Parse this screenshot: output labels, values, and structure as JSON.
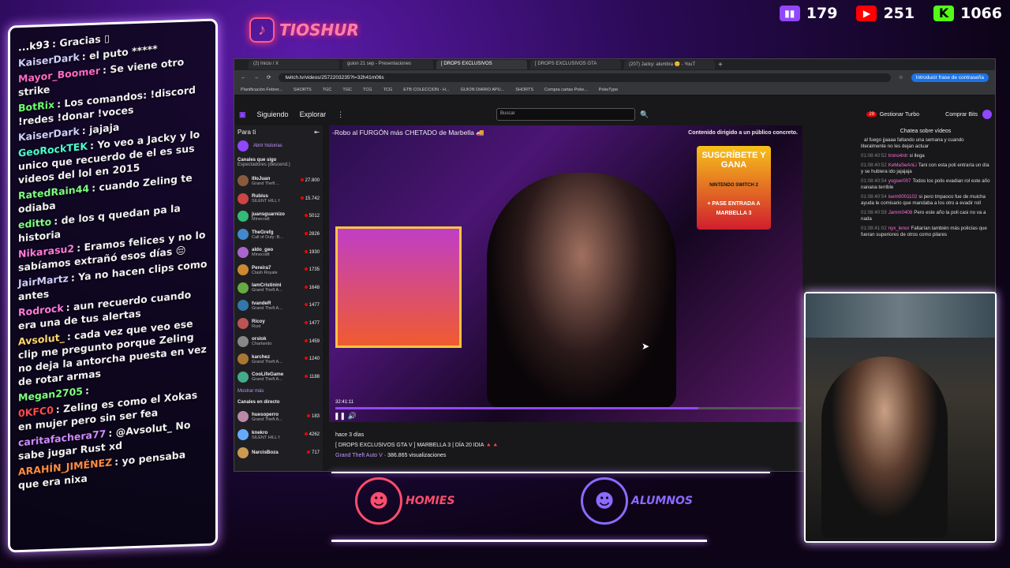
{
  "brand": {
    "name": "TIOSHUR",
    "logo": "tiktok-icon"
  },
  "stats": [
    {
      "platform": "twitch",
      "icon": "twitch-icon",
      "value": "179",
      "color": "#9146ff"
    },
    {
      "platform": "youtube",
      "icon": "youtube-icon",
      "value": "251",
      "color": "#ff0000"
    },
    {
      "platform": "kick",
      "icon": "kick-icon",
      "value": "1066",
      "color": "#53fc18"
    }
  ],
  "chat": [
    {
      "user": "...k93",
      "user_color": "#ffffff",
      "text": ": Gracias ▯"
    },
    {
      "user": "KaiserDark",
      "user_color": "#cfcfff",
      "text": ": el puto *****"
    },
    {
      "user": "Mayor_Boomer",
      "user_color": "#ff69c4",
      "text": ": Se viene otro strike"
    },
    {
      "user": "BotRix",
      "user_color": "#6cff6c",
      "text": ": Los comandos: !discord !redes !donar !voces"
    },
    {
      "user": "KaiserDark",
      "user_color": "#cfcfff",
      "text": ": jajaja"
    },
    {
      "user": "GeoRockTEK",
      "user_color": "#4cffd0",
      "text": ": Yo veo a Jacky y lo unico que recuerdo de el es sus videos del lol en 2015"
    },
    {
      "user": "RatedRain44",
      "user_color": "#7dff7d",
      "text": ": cuando Zeling te odiaba"
    },
    {
      "user": "editto",
      "user_color": "#7dff7d",
      "text": ": de los q quedan pa la historia"
    },
    {
      "user": "Nikarasu2",
      "user_color": "#ff7ad9",
      "text": ": Eramos felices y no lo sabíamos extrañó esos días 😔"
    },
    {
      "user": "JairMartz",
      "user_color": "#cfcfff",
      "text": ": Ya no hacen clips como antes"
    },
    {
      "user": "Rodrock",
      "user_color": "#ff7ad9",
      "text": ": aun recuerdo cuando era una de tus alertas"
    },
    {
      "user": "Avsolut_",
      "user_color": "#ffd66b",
      "text": ": cada vez que veo ese clip me pregunto porque Zeling no deja la antorcha puesta en vez de rotar armas"
    },
    {
      "user": "Megan2705",
      "user_color": "#7dff7d",
      "text": ":"
    },
    {
      "user": "0KFC0",
      "user_color": "#ff4a4a",
      "text": ": Zeling es como el Xokas en mujer pero sin ser fea"
    },
    {
      "user": "caritafachera77",
      "user_color": "#d08aff",
      "text": ": @Avsolut_ No sabe jugar Rust xd"
    },
    {
      "user": "ARAHÍN_JIMÉNEZ",
      "user_color": "#ff8c42",
      "text": ": yo pensaba que era nixa"
    }
  ],
  "browser": {
    "tabs": [
      "(2) Inicio / X",
      "guion 21 sep - Presentaciones",
      "[ DROPS EXCLUSIVOS",
      "[ DROPS EXCLUSIVOS GTA",
      "(207) Jacky: alumbra 😊 - YouT"
    ],
    "url": "twitch.tv/videos/2572203235?t=32h41m06s",
    "profile_hint": "Introducir frase de contraseña",
    "bookmarks": [
      "Planificación Febrer...",
      "SHORTS",
      "TGC",
      "TGC",
      "TCG",
      "TCG",
      "ETB COLECCION - H...",
      "GUION DIARIO APU...",
      "SHORTS",
      "Compra cartas Poke...",
      "PokeType"
    ]
  },
  "twitch": {
    "nav": [
      "Siguiendo",
      "Explorar"
    ],
    "search_placeholder": "Buscar",
    "notif_count": "29",
    "turbo": "Gestionar Turbo",
    "bits": "Comprar Bits",
    "sidebar_title": "Para ti",
    "abrir": "Abrir historias",
    "following_label": "Canales que sigo",
    "sort_label": "Espectadores (descend.)",
    "channels": [
      {
        "name": "IlloJuan",
        "game": "Grand Theft ...",
        "viewers": "27.800",
        "color": "#8a5a3c"
      },
      {
        "name": "Rubius",
        "game": "SILENT HILL f",
        "viewers": "15.742",
        "color": "#c44"
      },
      {
        "name": "juansguarnizo",
        "game": "Minecraft",
        "viewers": "5012",
        "color": "#3b7"
      },
      {
        "name": "TheGrefg",
        "game": "Call of Duty: B...",
        "viewers": "2826",
        "color": "#48c"
      },
      {
        "name": "aldo_geo",
        "game": "Minecraft",
        "viewers": "1930",
        "color": "#a6c"
      },
      {
        "name": "Pereira7",
        "game": "Clash Royale",
        "viewers": "1735",
        "color": "#c83"
      },
      {
        "name": "IamCristinini",
        "game": "Grand Theft A...",
        "viewers": "1648",
        "color": "#6a4"
      },
      {
        "name": "tvandeR",
        "game": "Grand Theft A...",
        "viewers": "1477",
        "color": "#37a"
      },
      {
        "name": "Ricoy",
        "game": "Rust",
        "viewers": "1477",
        "color": "#b55"
      },
      {
        "name": "orslok",
        "game": "Charlando",
        "viewers": "1459",
        "color": "#888"
      },
      {
        "name": "karchez",
        "game": "Grand Theft A...",
        "viewers": "1240",
        "color": "#a73"
      },
      {
        "name": "CooLifeGame",
        "game": "Grand Theft A...",
        "viewers": "1188",
        "color": "#4a8"
      }
    ],
    "show_more": "Mostrar más",
    "live_label": "Canales en directo",
    "live_channels": [
      {
        "name": "huesoperro",
        "game": "Grand Theft A...",
        "viewers": "183",
        "color": "#b8a"
      },
      {
        "name": "knekro",
        "game": "SILENT HILL f",
        "viewers": "4262",
        "color": "#6af"
      },
      {
        "name": "NarcisBoza",
        "game": "",
        "viewers": "717",
        "color": "#c95"
      }
    ],
    "video_title": "-Robo al FURGÓN más CHETADO de Marbella 🚚",
    "warning": "Contenido dirigido a un público concreto.",
    "promo": "SUSCRÍBETE Y GANA",
    "promo_sub": "+ PASE ENTRADA A MARBELLA 3",
    "promo_sub2": "NINTENDO SWITCH 2",
    "time": "32:41:11",
    "progress": 0.78,
    "meta_age": "hace 3 días",
    "meta_title": "[ DROPS EXCLUSIVOS GTA V ] MARBELLA 3 | DÍA 20 IDIA 🔺🔺",
    "meta_game": "Grand Theft Auto V",
    "meta_views": "386.865 visualizaciones",
    "chat_title": "Chatea sobre vídeos",
    "chat_msgs": [
      {
        "t": "",
        "user": "",
        "text": "al fuego jjaaaa faltando una semana y cuando literalmente no les dejan actuar"
      },
      {
        "t": "01:08:40:52",
        "user": "trono4ntr",
        "text": "si llega"
      },
      {
        "t": "01:08:40:52",
        "user": "KeMaSeAnLi",
        "text": "Tani con esta poli entraría un día y se hubiera ido jajajaja"
      },
      {
        "t": "01:08:40:54",
        "user": "yogser007",
        "text": "Todos los polis evadian rol este año nanana terrible"
      },
      {
        "t": "01:08:40:54",
        "user": "isem0001102",
        "text": "si pero tmpaoco fue de muicha ayuda le comisario que mandaba a los otro a evadir roll"
      },
      {
        "t": "01:08:40:59",
        "user": "Jamm0408",
        "text": "Pero este año la poli casi no va a nada"
      },
      {
        "t": "01:08:41:02",
        "user": "nyx_lenor",
        "text": "Faltarían también más policías que fueran superiores de otros como pilares"
      }
    ]
  },
  "teams": [
    {
      "name": "HOMIES",
      "color": "#ff4d6d"
    },
    {
      "name": "ALUMNOS",
      "color": "#8a6bff"
    }
  ]
}
